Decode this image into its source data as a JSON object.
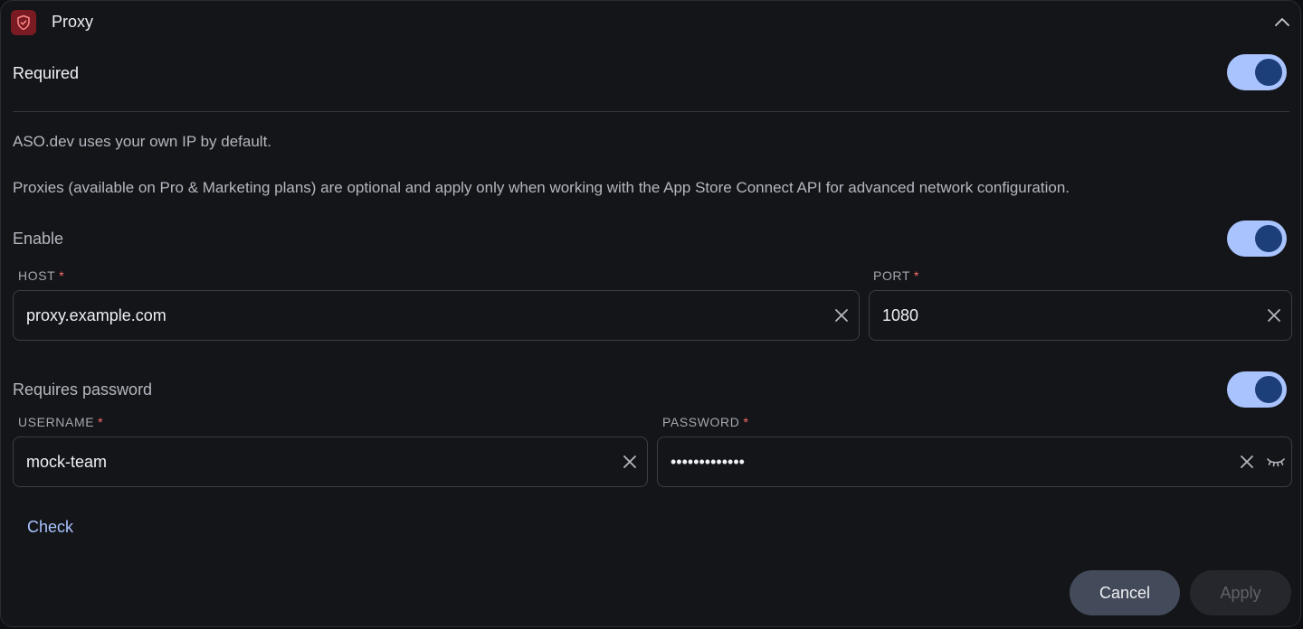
{
  "header": {
    "title": "Proxy",
    "icon": "shield-icon",
    "collapse_icon": "chevron-up-icon",
    "icon_bg": "#7a1a22"
  },
  "required": {
    "label": "Required",
    "enabled": true
  },
  "info": {
    "line1": "ASO.dev uses your own IP by default.",
    "line2": "Proxies (available on Pro & Marketing plans) are optional and apply only when working with the App Store Connect API for advanced network configuration."
  },
  "enable": {
    "label": "Enable",
    "enabled": true
  },
  "host": {
    "label": "HOST",
    "required_mark": "*",
    "value": "proxy.example.com"
  },
  "port": {
    "label": "PORT",
    "required_mark": "*",
    "value": "1080"
  },
  "requires_password": {
    "label": "Requires password",
    "enabled": true
  },
  "username": {
    "label": "USERNAME",
    "required_mark": "*",
    "value": "mock-team"
  },
  "password": {
    "label": "PASSWORD",
    "required_mark": "*",
    "value": "•••••••••••••"
  },
  "actions": {
    "check_label": "Check",
    "cancel_label": "Cancel",
    "apply_label": "Apply",
    "apply_disabled": true
  },
  "colors": {
    "accent": "#a9c3ff",
    "toggle_knob": "#1c3f7a",
    "required_star": "#ff6b6b"
  }
}
